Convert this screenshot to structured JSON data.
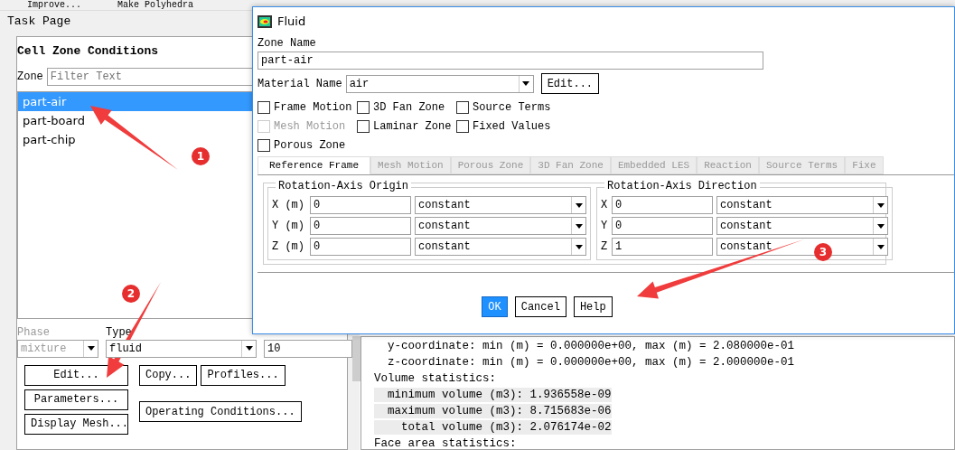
{
  "toolbar": {
    "items": [
      "Improve...",
      "Make Polyhedra"
    ]
  },
  "task_page": {
    "title": "Task Page",
    "heading": "Cell Zone Conditions",
    "zone_label": "Zone",
    "filter": {
      "placeholder": "Filter Text"
    },
    "zones": [
      {
        "label": "part-air",
        "selected": true
      },
      {
        "label": "part-board",
        "selected": false
      },
      {
        "label": "part-chip",
        "selected": false
      }
    ],
    "phase": {
      "label": "Phase",
      "value": "mixture",
      "disabled": true
    },
    "type": {
      "label": "Type",
      "value": "fluid",
      "disabled": false
    },
    "zone_id": "10",
    "buttons": [
      "Edit...",
      "Copy...",
      "Profiles...",
      "Parameters...",
      "Operating Conditions...",
      "Display Mesh..."
    ]
  },
  "dialog": {
    "title": "Fluid",
    "zone_name_label": "Zone Name",
    "zone_name": "part-air",
    "material_label": "Material Name",
    "material": "air",
    "material_edit": "Edit...",
    "options": [
      {
        "label": "Frame Motion",
        "checked": false,
        "disabled": false
      },
      {
        "label": "3D Fan Zone",
        "checked": false,
        "disabled": false
      },
      {
        "label": "Source Terms",
        "checked": false,
        "disabled": false
      },
      {
        "label": "Mesh Motion",
        "checked": false,
        "disabled": true
      },
      {
        "label": "Laminar Zone",
        "checked": false,
        "disabled": false
      },
      {
        "label": "Fixed Values",
        "checked": false,
        "disabled": false
      },
      {
        "label": "Porous Zone",
        "checked": false,
        "disabled": false
      }
    ],
    "tabs": [
      {
        "label": "Reference Frame",
        "selected": true
      },
      {
        "label": "Mesh Motion",
        "selected": false
      },
      {
        "label": "Porous Zone",
        "selected": false
      },
      {
        "label": "3D Fan Zone",
        "selected": false
      },
      {
        "label": "Embedded LES",
        "selected": false
      },
      {
        "label": "Reaction",
        "selected": false
      },
      {
        "label": "Source Terms",
        "selected": false
      },
      {
        "label": "Fixe",
        "selected": false
      }
    ],
    "groups": [
      {
        "title": "Rotation-Axis Origin",
        "rows": [
          {
            "axis": "X (m)",
            "value": "0",
            "method": "constant"
          },
          {
            "axis": "Y (m)",
            "value": "0",
            "method": "constant"
          },
          {
            "axis": "Z (m)",
            "value": "0",
            "method": "constant"
          }
        ]
      },
      {
        "title": "Rotation-Axis Direction",
        "rows": [
          {
            "axis": "X",
            "value": "0",
            "method": "constant"
          },
          {
            "axis": "Y",
            "value": "0",
            "method": "constant"
          },
          {
            "axis": "Z",
            "value": "1",
            "method": "constant"
          }
        ]
      }
    ],
    "buttons": [
      {
        "label": "OK",
        "primary": true
      },
      {
        "label": "Cancel",
        "primary": false
      },
      {
        "label": "Help",
        "primary": false
      }
    ]
  },
  "console": {
    "lines": [
      {
        "text": "  y-coordinate: min (m) = 0.000000e+00, max (m) = 2.080000e-01",
        "highlighted": false
      },
      {
        "text": "  z-coordinate: min (m) = 0.000000e+00, max (m) = 2.000000e-01",
        "highlighted": false
      },
      {
        "text": "Volume statistics:",
        "highlighted": false
      },
      {
        "text": "  minimum volume (m3): 1.936558e-09",
        "highlighted": true
      },
      {
        "text": "  maximum volume (m3): 8.715683e-06",
        "highlighted": true
      },
      {
        "text": "    total volume (m3): 2.076174e-02",
        "highlighted": true
      },
      {
        "text": "Face area statistics:",
        "highlighted": false
      }
    ]
  },
  "annotations": [
    {
      "number": "1"
    },
    {
      "number": "2"
    },
    {
      "number": "3"
    }
  ]
}
